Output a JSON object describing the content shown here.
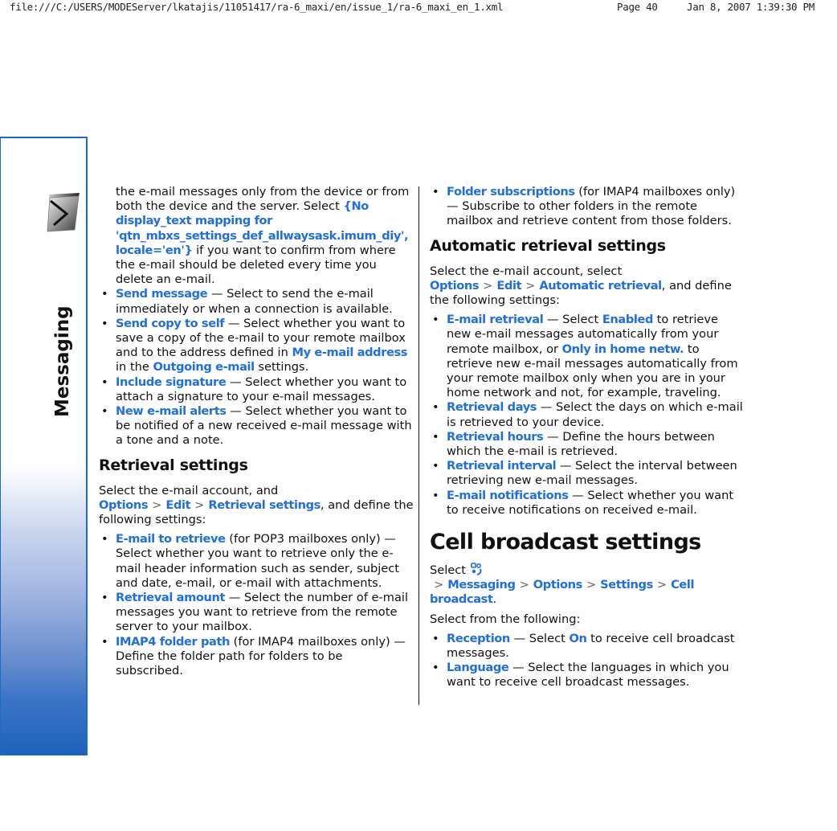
{
  "print_header": {
    "path": "file:///C:/USERS/MODEServer/lkatajis/11051417/ra-6_maxi/en/issue_1/ra-6_maxi_en_1.xml",
    "page": "Page 40",
    "datetime": "Jan 8, 2007 1:39:30 PM"
  },
  "side_tab": {
    "title": "Messaging",
    "icon": "messaging-envelope-icon",
    "page_number": "40"
  },
  "colors": {
    "link": "#1f6fe0",
    "tab_blue": "#1c6bc4",
    "text": "#111111"
  },
  "left_column": {
    "intro": {
      "text_before": "the e-mail messages only from the device or from both the device and the server. Select ",
      "link": "{No display_text mapping for 'qtn_mbxs_settings_def_allwaysask.imum_diy', locale='en'}",
      "text_after": " if you want to confirm from where the e-mail should be deleted every time you delete an e-mail."
    },
    "items": [
      {
        "term": "Send message",
        "desc": " — Select to send the e-mail immediately or when a connection is available."
      },
      {
        "term": "Send copy to self",
        "desc": " — Select whether you want to save a copy of the e-mail to your remote mailbox and to the address defined in ",
        "link2": "My e-mail address",
        "mid": " in the ",
        "link3": "Outgoing e-mail",
        "end": " settings."
      },
      {
        "term": "Include signature",
        "desc": " — Select whether you want to attach a signature to your e-mail messages."
      },
      {
        "term": "New e-mail alerts",
        "desc": " — Select whether you want to be notified of a new received e-mail message with a tone and a note."
      }
    ],
    "retrieval": {
      "heading": "Retrieval settings",
      "path_prefix": "Select the e-mail account, and ",
      "path": [
        "Options",
        "Edit",
        "Retrieval settings"
      ],
      "path_suffix": ", and define the following settings:",
      "items": [
        {
          "term": "E-mail to retrieve",
          "desc": " (for POP3 mailboxes only) — Select whether you want to retrieve only the e-mail header information such as sender, subject and date, e-mail, or e-mail with attachments."
        },
        {
          "term": "Retrieval amount",
          "desc": " — Select the number of e-mail messages you want to retrieve from the remote server to your mailbox."
        },
        {
          "term": "IMAP4 folder path",
          "desc": " (for IMAP4 mailboxes only) — Define the folder path for folders to be subscribed."
        }
      ]
    }
  },
  "right_column": {
    "items_top": [
      {
        "term": "Folder subscriptions",
        "desc": " (for IMAP4 mailboxes only) — Subscribe to other folders in the remote mailbox and retrieve content from those folders."
      }
    ],
    "auto_retrieval": {
      "heading": "Automatic retrieval settings",
      "path_prefix": "Select the e-mail account, select ",
      "path": [
        "Options",
        "Edit",
        "Automatic retrieval"
      ],
      "path_suffix": ", and define the following settings:",
      "items": [
        {
          "term": "E-mail retrieval",
          "desc_a": " — Select ",
          "link2": "Enabled",
          "desc_b": " to retrieve new e-mail messages automatically from your remote mailbox, or ",
          "link3": "Only in home netw.",
          "desc_c": " to retrieve new e-mail messages automatically from your remote mailbox only when you are in your home network and not, for example, traveling."
        },
        {
          "term": "Retrieval days",
          "desc": " — Select the days on which e-mail is retrieved to your device."
        },
        {
          "term": "Retrieval hours",
          "desc": " — Define the hours between which the e-mail is retrieved."
        },
        {
          "term": "Retrieval interval",
          "desc": " — Select the interval between retrieving new e-mail messages."
        },
        {
          "term": "E-mail notifications",
          "desc": " — Select whether you want to receive notifications on received e-mail."
        }
      ]
    },
    "cell_broadcast": {
      "heading": "Cell broadcast settings",
      "path_prefix": "Select ",
      "menu_icon": "menu-key-icon",
      "path": [
        "Messaging",
        "Options",
        "Settings",
        "Cell broadcast"
      ],
      "path_suffix": ".",
      "select_from": "Select from the following:",
      "items": [
        {
          "term": "Reception",
          "desc_a": " — Select ",
          "link2": "On",
          "desc_b": " to receive cell broadcast messages."
        },
        {
          "term": "Language",
          "desc": " — Select the languages in which you want to receive cell broadcast messages."
        }
      ]
    }
  },
  "path_separator": ">"
}
